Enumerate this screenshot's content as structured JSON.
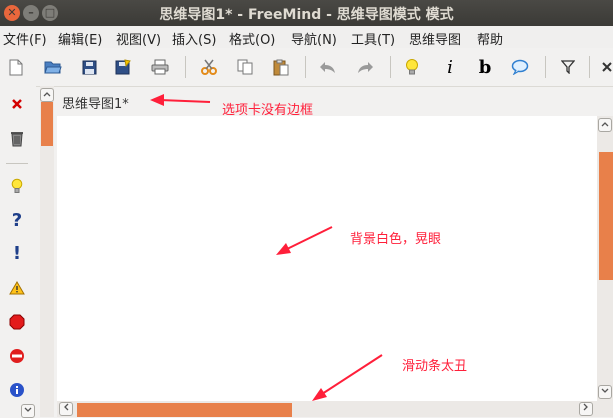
{
  "window": {
    "title": "思维导图1* - FreeMind - 思维导图模式 模式"
  },
  "window_controls": {
    "close": "✕",
    "minimize": "–",
    "maximize": "□"
  },
  "menu": [
    "文件(F)",
    "编辑(E)",
    "视图(V)",
    "插入(S)",
    "格式(O)",
    "导航(N)",
    "工具(T)",
    "思维导图",
    "帮助"
  ],
  "toolbar": {
    "italic": "i",
    "bold": "b"
  },
  "tab": {
    "label": "思维导图1*"
  },
  "annotations": {
    "tab_note": "选项卡没有边框",
    "bg_note": "背景白色，晃眼",
    "scroll_note": "滑动条太丑"
  },
  "left_toolbar": {
    "question": "?",
    "exclamation": "!"
  },
  "colors": {
    "scroll_thumb": "#e8804a",
    "annotation": "#ff1f3a",
    "titlebar": "#3c3b37",
    "canvas": "#ffffff"
  }
}
